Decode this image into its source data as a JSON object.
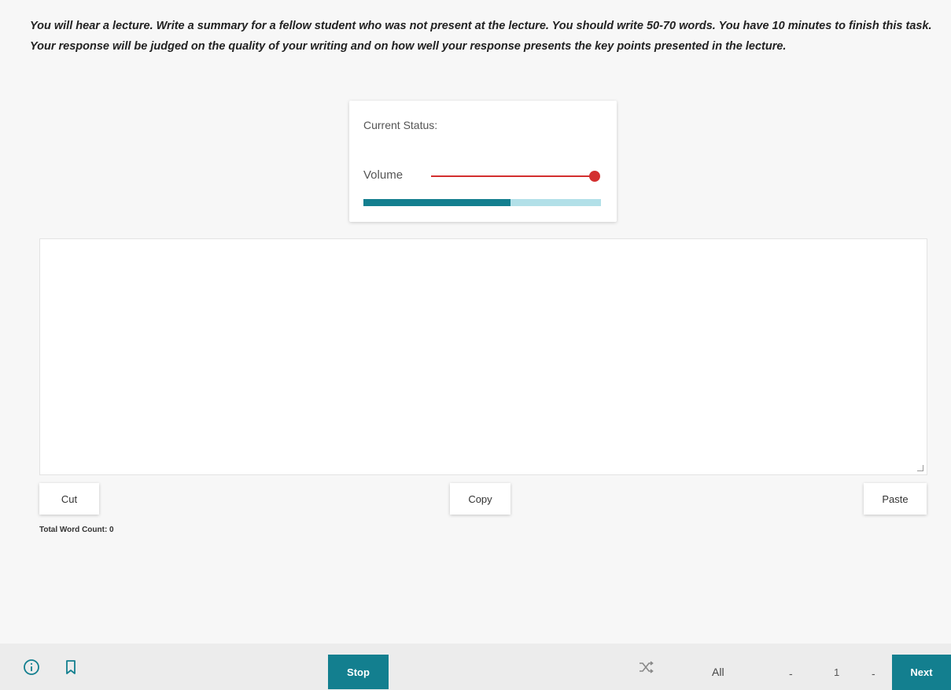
{
  "instructions": "You will hear a lecture. Write a summary for a fellow student who was not present at the lecture. You should write 50-70 words. You have 10 minutes to finish this task. Your response will be judged on the quality of your writing and on how well your response presents the key points presented in the lecture.",
  "status_card": {
    "status_label": "Current Status:",
    "volume_label": "Volume",
    "volume_level": 1.0,
    "playback_progress": 0.62,
    "colors": {
      "volume": "#d32f2f",
      "progress_fill": "#137f8f",
      "progress_track": "#b2e0e8"
    }
  },
  "editor": {
    "value": "",
    "cut_label": "Cut",
    "copy_label": "Copy",
    "paste_label": "Paste",
    "word_count_text": "Total Word Count: 0"
  },
  "bottom_bar": {
    "info_icon": "info-icon",
    "bookmark_icon": "bookmark-icon",
    "stop_label": "Stop",
    "shuffle_icon": "shuffle-icon",
    "filter_value": "All",
    "prev_arrow": "-",
    "page_number": "1",
    "next_arrow": "-",
    "next_label": "Next",
    "accent_color": "#137f8f"
  }
}
